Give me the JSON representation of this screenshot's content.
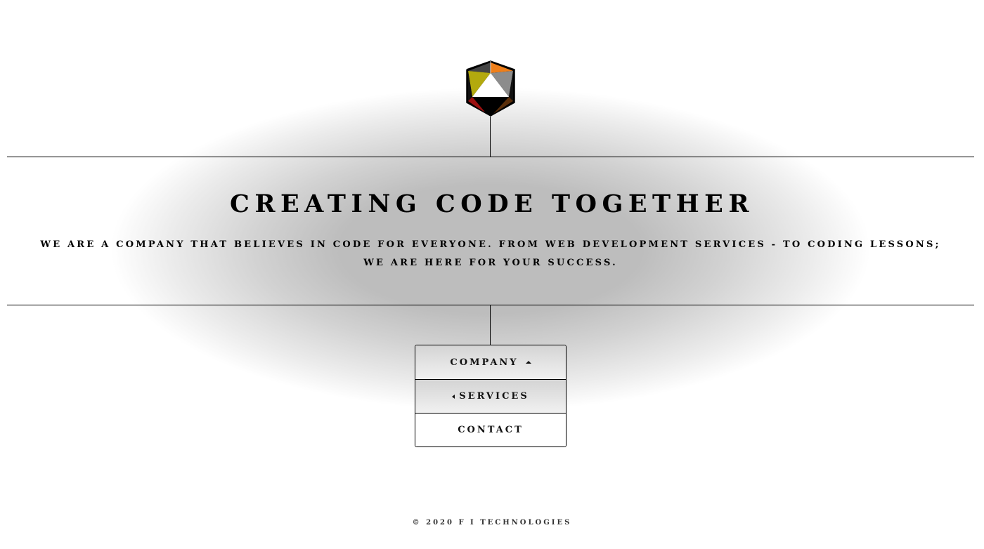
{
  "header": {
    "logo_icon": "icosahedron-logo-icon",
    "logo_colors": [
      "#ef7f1a",
      "#8c8c8c",
      "#b3a90e",
      "#ffffff",
      "#9c1010",
      "#5a2e0a",
      "#000000",
      "#444444"
    ]
  },
  "hero": {
    "headline": "CREATING CODE TOGETHER",
    "tagline": "WE ARE A COMPANY THAT BELIEVES IN CODE FOR EVERYONE. FROM WEB DEVELOPMENT SERVICES - TO CODING LESSONS; WE ARE HERE FOR YOUR SUCCESS."
  },
  "nav": {
    "items": [
      {
        "label": "COMPANY",
        "icon": "caret-up-icon"
      },
      {
        "label": "SERVICES",
        "icon": "caret-left-icon"
      },
      {
        "label": "CONTACT"
      }
    ]
  },
  "footer": {
    "copyright": "© 2020 F I TECHNOLOGIES"
  }
}
